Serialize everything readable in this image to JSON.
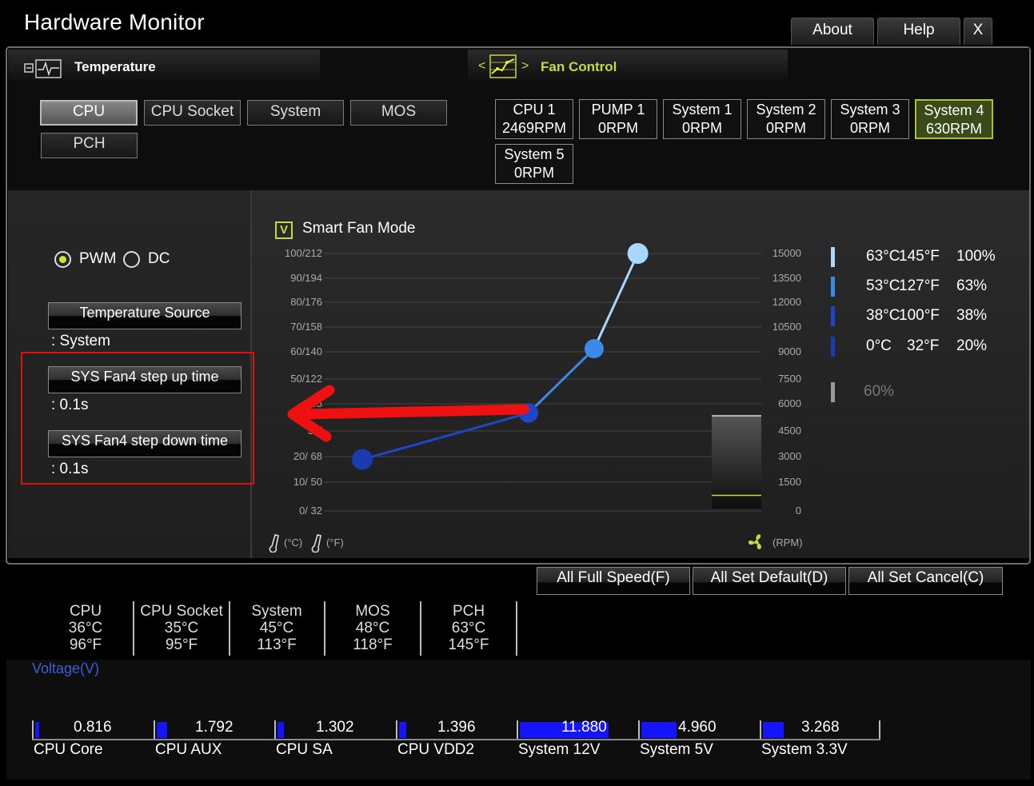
{
  "app": {
    "title": "Hardware Monitor",
    "buttons": [
      {
        "label": "About"
      },
      {
        "label": "Help"
      },
      {
        "label": "X"
      }
    ]
  },
  "temperature": {
    "title": "Temperature",
    "sources": [
      {
        "label": "CPU",
        "selected": true
      },
      {
        "label": "CPU Socket",
        "selected": false
      },
      {
        "label": "System",
        "selected": false
      },
      {
        "label": "MOS",
        "selected": false
      },
      {
        "label": "PCH",
        "selected": false
      }
    ]
  },
  "fan_control": {
    "title": "Fan Control",
    "nav_prev": "<",
    "nav_next": ">",
    "fans": [
      {
        "name": "CPU 1",
        "rpm": "2469RPM",
        "selected": false
      },
      {
        "name": "PUMP 1",
        "rpm": "0RPM",
        "selected": false
      },
      {
        "name": "System 1",
        "rpm": "0RPM",
        "selected": false
      },
      {
        "name": "System 2",
        "rpm": "0RPM",
        "selected": false
      },
      {
        "name": "System 3",
        "rpm": "0RPM",
        "selected": false
      },
      {
        "name": "System 4",
        "rpm": "630RPM",
        "selected": true
      },
      {
        "name": "System 5",
        "rpm": "0RPM",
        "selected": false
      }
    ]
  },
  "mode": {
    "pwm": "PWM",
    "dc": "DC",
    "selected": "PWM"
  },
  "settings": {
    "temp_source_label": "Temperature Source",
    "temp_source_value": ": System",
    "step_up_label": "SYS Fan4 step up time",
    "step_up_value": ": 0.1s",
    "step_down_label": "SYS Fan4 step down time",
    "step_down_value": ": 0.1s"
  },
  "smart_fan": {
    "label": "Smart Fan Mode",
    "checked": true,
    "check_glyph": "V"
  },
  "chart_data": {
    "type": "line",
    "left_axis_ticks": [
      "100/212",
      "90/194",
      "80/176",
      "70/158",
      "60/140",
      "50/122",
      "45",
      "30/",
      "20/ 68",
      "10/ 50",
      "0/ 32"
    ],
    "right_axis_ticks": [
      "15000",
      "13500",
      "12000",
      "10500",
      "9000",
      "7500",
      "6000",
      "4500",
      "3000",
      "1500",
      "0"
    ],
    "left_axis_unit_c": "(°C)",
    "left_axis_unit_f": "(°F)",
    "right_axis_unit": "(RPM)",
    "points": [
      {
        "x": 0,
        "y": 20
      },
      {
        "x": 38,
        "y": 38
      },
      {
        "x": 53,
        "y": 63
      },
      {
        "x": 63,
        "y": 100
      }
    ],
    "xlim": [
      0,
      100
    ],
    "ylim": [
      0,
      100
    ],
    "point_colors": [
      "#1b3bb0",
      "#1d47c8",
      "#3a8ae8",
      "#a8d8ff"
    ],
    "current_rpm": 630
  },
  "legend": [
    {
      "c": "63°C",
      "f": "145°F",
      "p": "100%",
      "color": "#a8d8ff"
    },
    {
      "c": "53°C",
      "f": "127°F",
      "p": "63%",
      "color": "#3a8ae8"
    },
    {
      "c": "38°C",
      "f": "100°F",
      "p": "38%",
      "color": "#1d47c8"
    },
    {
      "c": "0°C",
      "f": "32°F",
      "p": "20%",
      "color": "#1b3bb0"
    },
    {
      "p": "60%",
      "color": "#999"
    }
  ],
  "actions": {
    "full_speed": "All Full Speed(F)",
    "set_default": "All Set Default(D)",
    "set_cancel": "All Set Cancel(C)"
  },
  "temps": [
    {
      "name": "CPU",
      "c": "36°C",
      "f": "96°F"
    },
    {
      "name": "CPU Socket",
      "c": "35°C",
      "f": "95°F"
    },
    {
      "name": "System",
      "c": "45°C",
      "f": "113°F"
    },
    {
      "name": "MOS",
      "c": "48°C",
      "f": "118°F"
    },
    {
      "name": "PCH",
      "c": "63°C",
      "f": "145°F"
    }
  ],
  "voltage": {
    "title": "Voltage(V)",
    "items": [
      {
        "name": "CPU Core",
        "value": "0.816",
        "fill": 0.03
      },
      {
        "name": "CPU AUX",
        "value": "1.792",
        "fill": 0.1
      },
      {
        "name": "CPU SA",
        "value": "1.302",
        "fill": 0.06
      },
      {
        "name": "CPU VDD2",
        "value": "1.396",
        "fill": 0.07
      },
      {
        "name": "System 12V",
        "value": "11.880",
        "fill": 0.87
      },
      {
        "name": "System 5V",
        "value": "4.960",
        "fill": 0.34
      },
      {
        "name": "System 3.3V",
        "value": "3.268",
        "fill": 0.2
      }
    ]
  }
}
